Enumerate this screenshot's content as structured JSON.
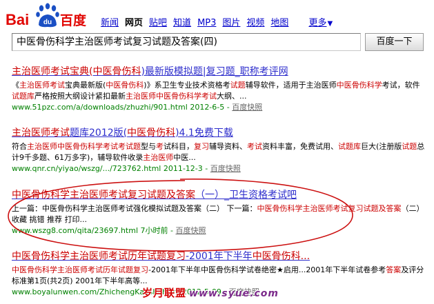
{
  "brand": {
    "logo_text_bai": "Bai",
    "logo_text_du": "du",
    "logo_text_cn": "百度"
  },
  "nav": {
    "items": [
      {
        "label": "新闻",
        "active": false
      },
      {
        "label": "网页",
        "active": true
      },
      {
        "label": "贴吧",
        "active": false
      },
      {
        "label": "知道",
        "active": false
      },
      {
        "label": "MP3",
        "active": false
      },
      {
        "label": "图片",
        "active": false
      },
      {
        "label": "视频",
        "active": false
      },
      {
        "label": "地图",
        "active": false
      }
    ],
    "more_label": "更多"
  },
  "search": {
    "query": "中医骨伤科学主治医师考试复习试题及答案(四)",
    "button_label": "百度一下"
  },
  "results": [
    {
      "title_a": "主治医师考试宝典",
      "title_b": "(中医骨伤科",
      "title_c": ")最新版模拟题|复习题_职称考评网",
      "abs_1": "《",
      "abs_2": "主治医师考试",
      "abs_3": "宝典最新版(",
      "abs_4": "中医骨伤科",
      "abs_5": ")》系卫生专业技术资格考",
      "abs_6": "试题",
      "abs_7": "辅导软件，适用于主治医师",
      "abs_8": "中医骨伤科学",
      "abs_9": "考试，软件",
      "abs_10": "试题库",
      "abs_11": "严格按照大纲设计紧扣最新",
      "abs_12": "主治医师中医骨伤科学考试",
      "abs_13": "大纲、...",
      "url": "www.51pzc.com/a/downloads/zhuzhi/901.html 2012-6-5",
      "snapshot": "百度快照"
    },
    {
      "title_a": "主治医师考试",
      "title_b": "题库2012版(",
      "title_c": "中医骨伤科",
      "title_d": ")4.1免费下载",
      "abs_1": "符合",
      "abs_2": "主治医师中医骨伤科学考试考试题",
      "abs_3": "型与",
      "abs_4": "考",
      "abs_5": "试科目，",
      "abs_6": "复习",
      "abs_7": "辅导资料、",
      "abs_8": "考试",
      "abs_9": "资料丰富，免费试用、",
      "abs_10": "试题库",
      "abs_11": "巨大(注册版",
      "abs_12": "试题",
      "abs_13": "总计9千多题、61万多字)，辅导软件收录",
      "abs_14": "主治医师",
      "abs_15": "中医...",
      "url": "www.qnr.cn/yiyao/wszg/.../723762.html 2011-12-3",
      "snapshot": "百度快照"
    },
    {
      "title_a": "中医骨伤科学主治医师考试复习试题及答案",
      "title_b": "（一）",
      "title_c": "_卫生资格考试吧",
      "abs_1": "上一篇：中医骨伤科学主治医师考试强化模拟试题及答案（二） 下一篇：",
      "abs_2": "中医骨伤科学主治医师考试复习试题及答案",
      "abs_3": "（二） 收藏 挑错 推荐 打印...",
      "url": "www.wszg8.com/qita/23697.html 7小时前",
      "snapshot": "百度快照"
    },
    {
      "title_a": "中医骨伤科学主治医师考试历年试题",
      "title_b": "复习",
      "title_c": "-2001年下半年",
      "title_d": "中医骨伤科...",
      "abs_1": "中医骨伤科学主治医师考试",
      "abs_2": "历年试题",
      "abs_3": "复习",
      "abs_4": "-2001年下半年中医骨伤科学试卷绝密★启用...2001年下半年试卷参考",
      "abs_5": "答案",
      "abs_6": "及评分标准第1页(共2页) 2001年下半年高等...",
      "url": "www.boyalunwen.com/ZhichengKaoshi/html/2012-5-09",
      "snapshot": "百度快照"
    }
  ],
  "watermark": {
    "text": "岁月联盟",
    "url": "www.syue.com"
  },
  "colors": {
    "link_blue": "#2d2dcc",
    "highlight_red": "#cc0000",
    "url_green": "#008000",
    "annotation_red": "#cc1010"
  }
}
